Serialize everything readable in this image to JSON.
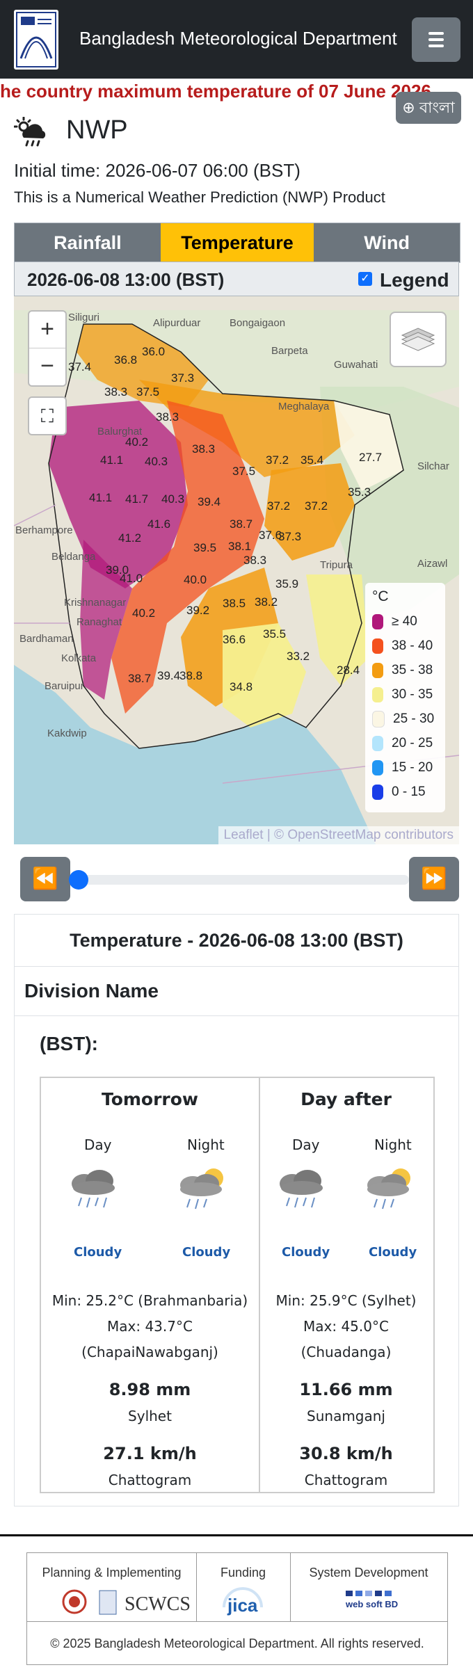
{
  "header": {
    "title": "Bangladesh Meteorological Department",
    "menu_icon": "hamburger-icon"
  },
  "ticker": "he country maximum temperature of 07 June 2026",
  "language_button": "বাংলা",
  "page": {
    "title": "NWP",
    "initial_time": "Initial time: 2026-06-07 06:00 (BST)",
    "description": "This is a Numerical Weather Prediction (NWP) Product"
  },
  "tabs": [
    "Rainfall",
    "Temperature",
    "Wind"
  ],
  "active_tab": "Temperature",
  "datebar": {
    "datetime": "2026-06-08 13:00 (BST)",
    "legend_label": "Legend",
    "legend_checked": true
  },
  "map": {
    "zoom_in": "+",
    "zoom_out": "−",
    "attribution": "Leaflet | © OpenStreetMap contributors",
    "places": [
      "Siliguri",
      "Alipurduar",
      "Bongaigaon",
      "Barpeta",
      "Guwahati",
      "Meghalaya",
      "Silchar",
      "Balurghat",
      "Berhampore",
      "Beldanga",
      "Krishnanagar",
      "Ranaghat",
      "Bardhaman",
      "Kolkata",
      "Baruipur",
      "Kakdwip",
      "Tripura",
      "Aizawl"
    ],
    "values": [
      "37.4",
      "36.8",
      "36.0",
      "37.3",
      "38.3",
      "37.5",
      "38.3",
      "40.2",
      "41.1",
      "40.3",
      "38.3",
      "37.5",
      "37.2",
      "35.4",
      "27.7",
      "35.3",
      "41.1",
      "41.7",
      "40.3",
      "39.4",
      "37.2",
      "37.2",
      "41.6",
      "38.7",
      "37.6",
      "37.3",
      "41.2",
      "39.5",
      "38.1",
      "39.0",
      "41.0",
      "40.0",
      "38.3",
      "35.9",
      "40.2",
      "39.2",
      "38.5",
      "38.2",
      "36.6",
      "35.5",
      "38.7",
      "39.4",
      "38.8",
      "33.2",
      "34.8",
      "28.4"
    ]
  },
  "legend": {
    "unit": "°C",
    "items": [
      {
        "label": "≥ 40",
        "color": "#b0177a"
      },
      {
        "label": "38 - 40",
        "color": "#f4511e"
      },
      {
        "label": "35 - 38",
        "color": "#f39c12"
      },
      {
        "label": "30 - 35",
        "color": "#f5ef8f"
      },
      {
        "label": "25 - 30",
        "color": "#fbf6e4"
      },
      {
        "label": "20 - 25",
        "color": "#b3e5fc"
      },
      {
        "label": "15 - 20",
        "color": "#2196f3"
      },
      {
        "label": "0 - 15",
        "color": "#1a3ee8"
      }
    ]
  },
  "player": {
    "prev": "⏪",
    "next": "⏩",
    "progress": 0
  },
  "forecast": {
    "heading": "Temperature - 2026-06-08 13:00 (BST)",
    "division_name": "Division Name",
    "bst_label": "(BST):",
    "tomorrow": {
      "title": "Tomorrow",
      "day": "Day",
      "night": "Night",
      "day_weather": "Cloudy",
      "night_weather": "Cloudy",
      "min": "Min: 25.2°C (Brahmanbaria)",
      "max_line1": "Max: 43.7°C",
      "max_line2": "(ChapaiNawabganj)",
      "rain": "8.98 mm",
      "rain_place": "Sylhet",
      "wind": "27.1 km/h",
      "wind_place": "Chattogram"
    },
    "day_after": {
      "title": "Day after",
      "day": "Day",
      "night": "Night",
      "day_weather": "Cloudy",
      "night_weather": "Cloudy",
      "min": "Min: 25.9°C (Sylhet)",
      "max_line1": "Max: 45.0°C",
      "max_line2": "(Chuadanga)",
      "rain": "11.66 mm",
      "rain_place": "Sunamganj",
      "wind": "30.8 km/h",
      "wind_place": "Chattogram"
    }
  },
  "footer": {
    "planning": "Planning & Implementing",
    "funding": "Funding",
    "system": "System Development",
    "scwcs": "SCWCS",
    "jica": "jica",
    "websoft": "web soft BD",
    "copyright": "© 2025 Bangladesh Meteorological Department. All rights reserved."
  }
}
